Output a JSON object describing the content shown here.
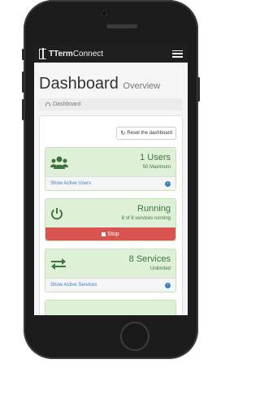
{
  "app": {
    "brand": "TTermConnect",
    "brand_parts": {
      "bold": "TTerm",
      "rest": "Connect"
    }
  },
  "page": {
    "title": "Dashboard",
    "subtitle": "Overview",
    "breadcrumb": "Dashboard"
  },
  "toolbar": {
    "reset_label": "Reset the dashboard"
  },
  "cards": {
    "users": {
      "value": "1 Users",
      "sub": "50 Maximum",
      "link": "Show Active Users"
    },
    "status": {
      "value": "Running",
      "sub": "8 of 8 services running",
      "stop_label": "Stop"
    },
    "services": {
      "value": "8 Services",
      "sub": "Unlimited",
      "link": "Show Active Services"
    }
  },
  "colors": {
    "success_bg": "#dff0d8",
    "success_text": "#3c763d",
    "danger": "#d9534f",
    "link": "#3a7fc0",
    "navbar": "#1f1f1f"
  },
  "icons": [
    "users-icon",
    "power-icon",
    "exchange-icon",
    "refresh-icon",
    "arrow-circle-right-icon",
    "stop-icon",
    "menu-icon",
    "dashboard-icon"
  ]
}
